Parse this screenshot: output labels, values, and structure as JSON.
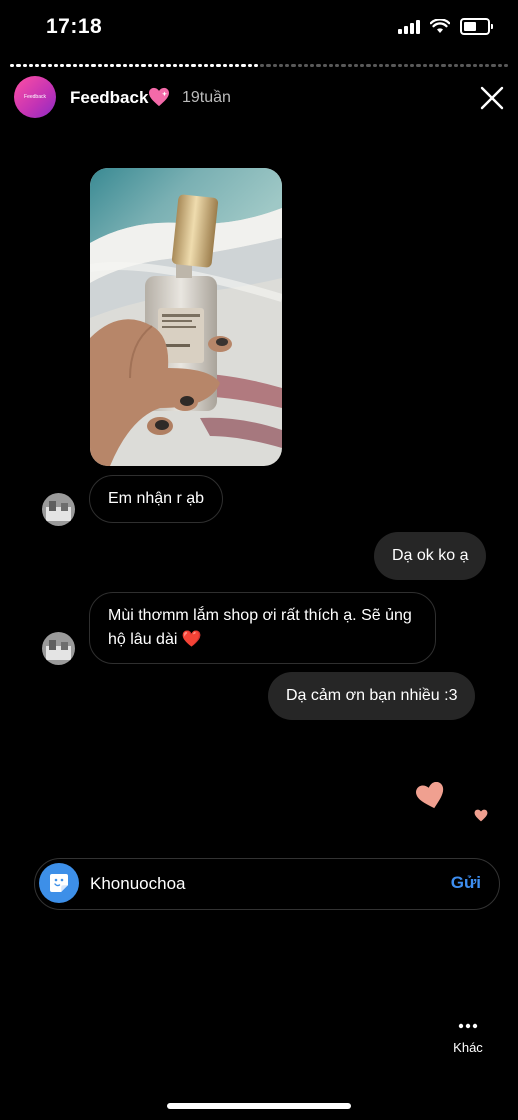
{
  "status_bar": {
    "time": "17:18"
  },
  "story": {
    "name": "Feedback",
    "avatar_text": "Feedback",
    "age": "19tuần",
    "progress_segments": [
      1,
      1,
      1,
      1,
      1,
      1,
      1,
      1,
      1,
      1,
      1,
      1,
      1,
      1,
      1,
      1,
      1,
      1,
      1,
      1,
      1,
      1,
      1,
      1,
      1,
      1,
      1,
      1,
      1,
      1,
      1,
      1,
      1,
      1,
      1,
      1,
      1,
      1,
      1,
      1,
      0,
      0,
      0,
      0,
      0,
      0,
      0,
      0,
      0,
      0,
      0,
      0,
      0,
      0,
      0,
      0,
      0,
      0,
      0,
      0,
      0,
      0,
      0,
      0,
      0,
      0,
      0,
      0,
      0,
      0,
      0,
      0,
      0,
      0,
      0,
      0,
      0,
      0,
      0,
      0
    ]
  },
  "messages": [
    {
      "direction": "incoming",
      "text": "Em nhận r ạb"
    },
    {
      "direction": "outgoing",
      "text": "Dạ ok ko ạ"
    },
    {
      "direction": "incoming",
      "text": "Mùi thơmm lắm shop ơi rất thích ạ. Sẽ ủng hộ lâu dài ❤️"
    },
    {
      "direction": "outgoing",
      "text": "Dạ cảm ơn bạn nhiều :3"
    }
  ],
  "reply_bar": {
    "username": "Khonuochoa",
    "send_label": "Gửi"
  },
  "more": {
    "label": "Khác"
  },
  "colors": {
    "accent": "#3e8ef0",
    "heart": "#f0a090"
  }
}
